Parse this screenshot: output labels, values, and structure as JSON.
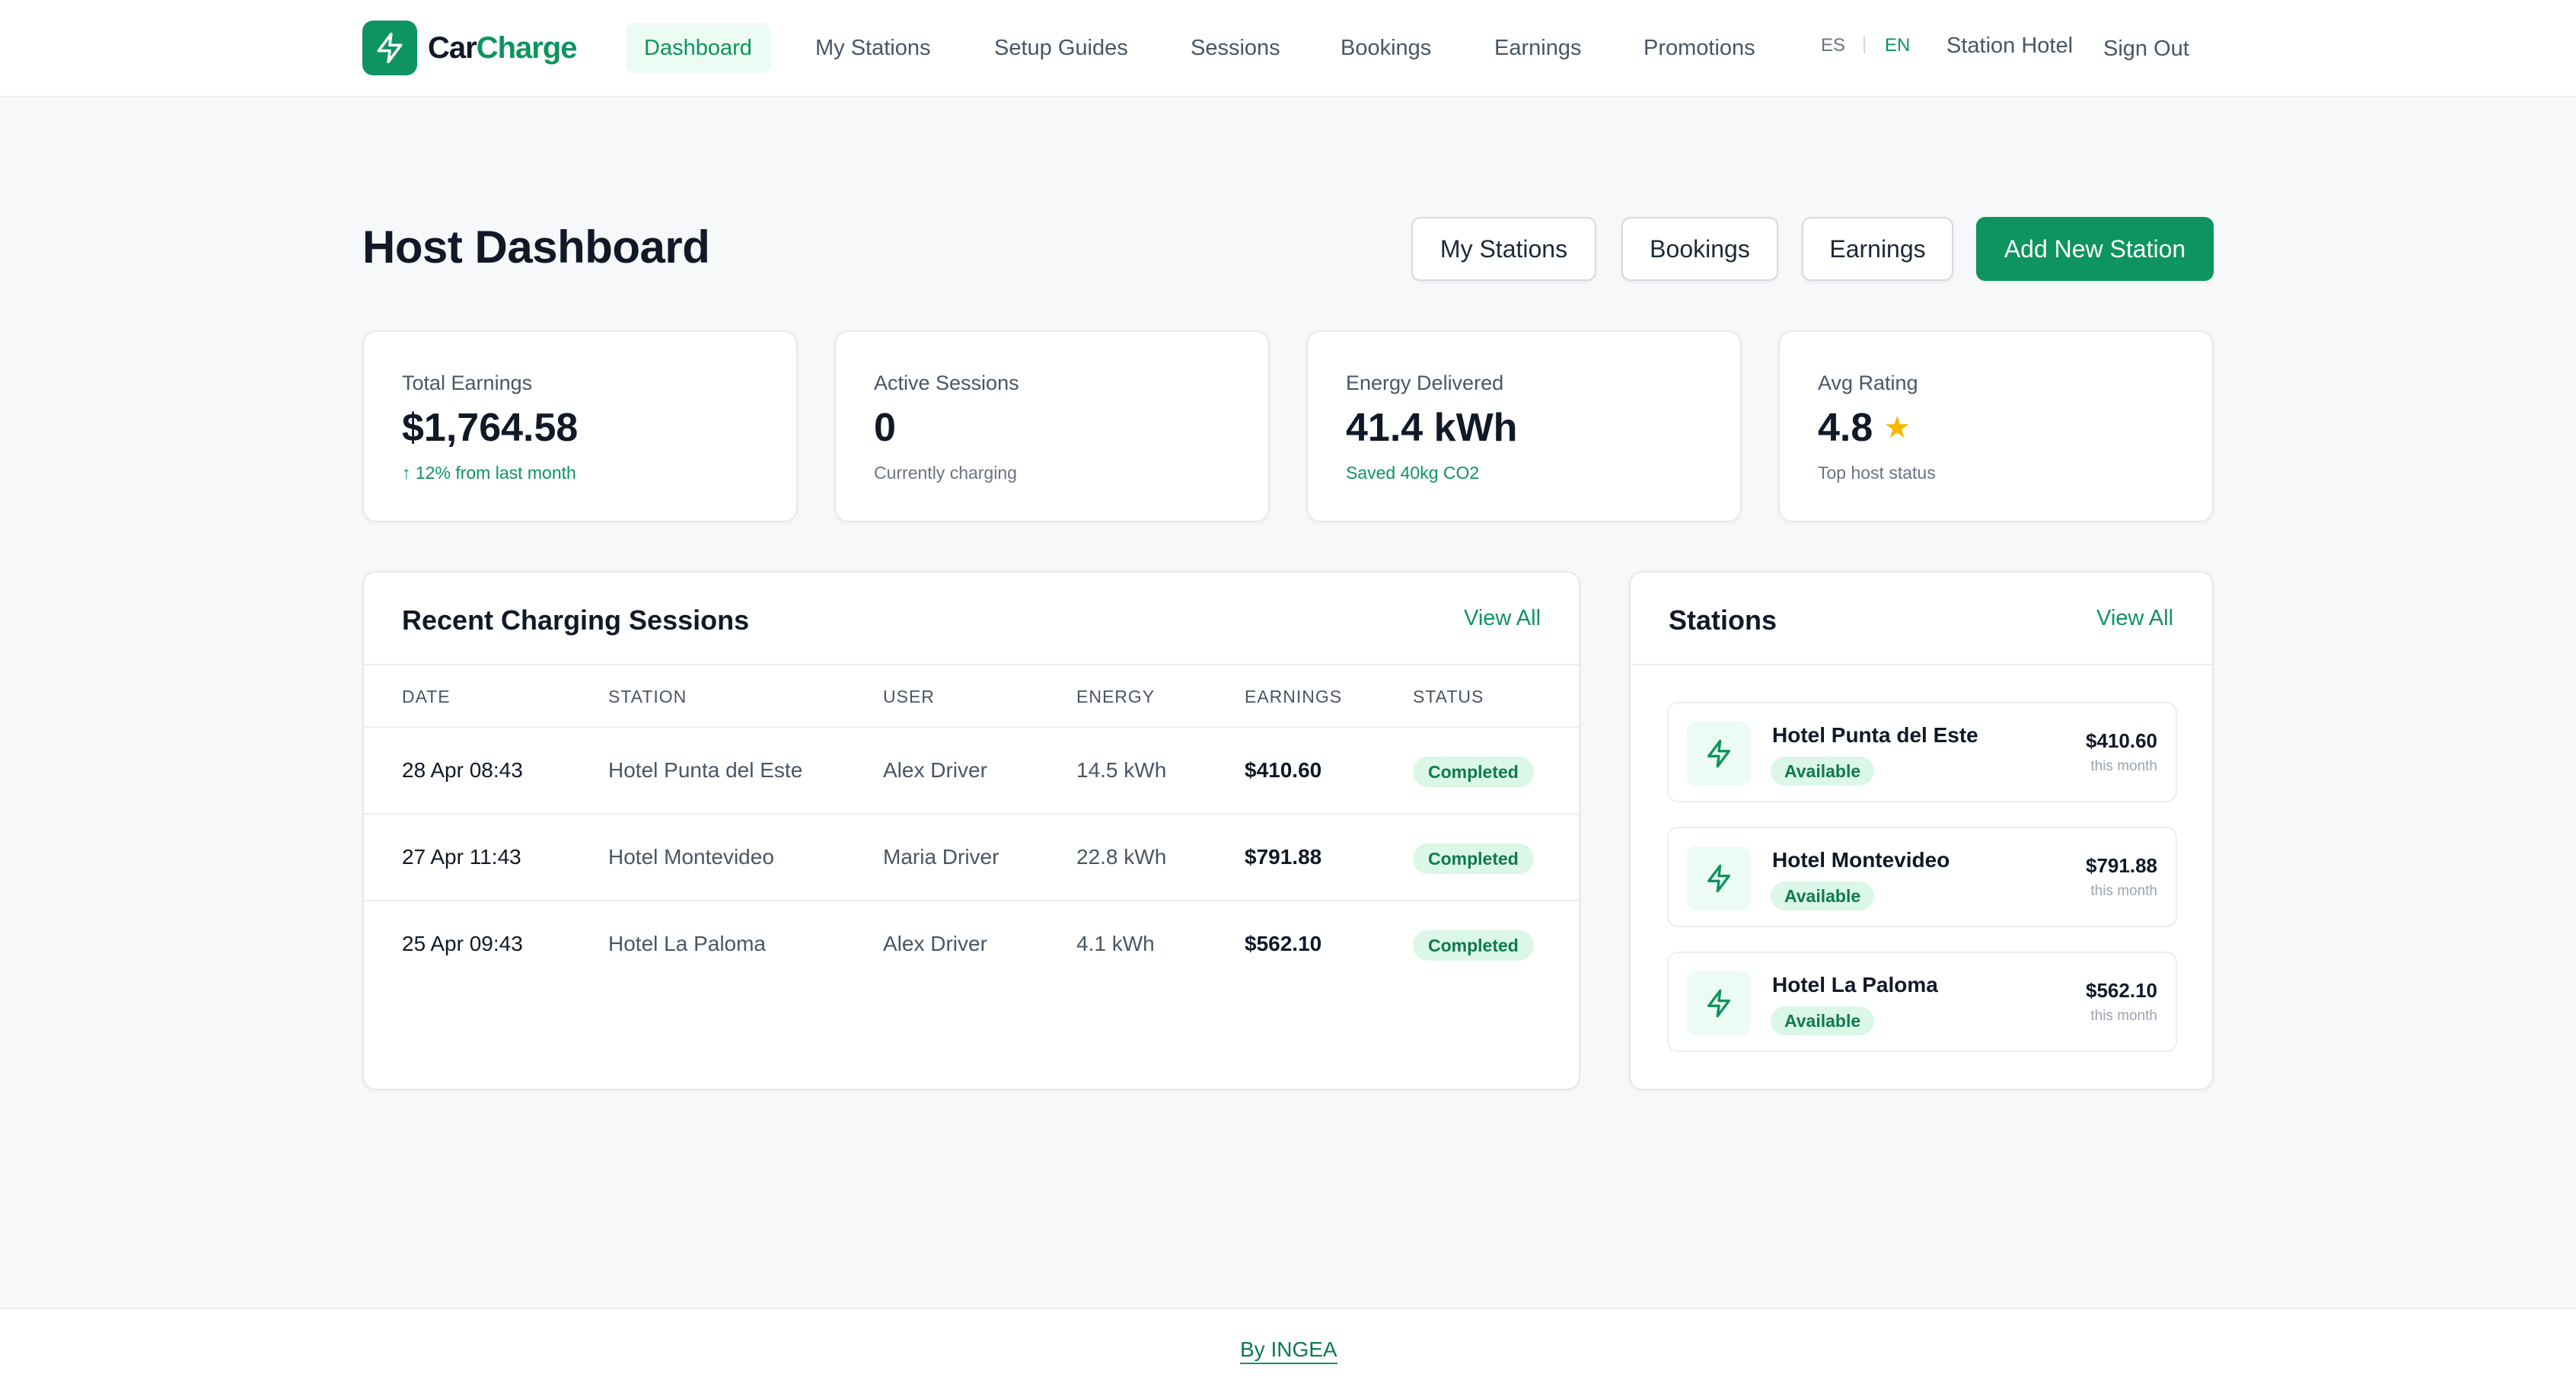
{
  "brand": {
    "part1": "Car",
    "part2": "Charge",
    "accent": "#0d9460",
    "icon": "lightning-bolt-icon"
  },
  "nav": {
    "items": [
      "Dashboard",
      "My Stations",
      "Setup Guides",
      "Sessions",
      "Bookings",
      "Earnings",
      "Promotions"
    ],
    "active": "Dashboard",
    "lang_es": "ES",
    "lang_sep": "|",
    "lang_en": "EN",
    "active_lang": "EN",
    "user": "Station Hotel",
    "sign_out": "Sign Out"
  },
  "header": {
    "title": "Host Dashboard",
    "btn_stations": "My Stations",
    "btn_bookings": "Bookings",
    "btn_earnings": "Earnings",
    "btn_add": "Add New Station"
  },
  "stats": [
    {
      "label": "Total Earnings",
      "value": "$1,764.58",
      "sub": "↑ 12% from last month",
      "sub_color": "green"
    },
    {
      "label": "Active Sessions",
      "value": "0",
      "sub": "Currently charging",
      "sub_color": "gray"
    },
    {
      "label": "Energy Delivered",
      "value": "41.4 kWh",
      "sub": "Saved 40kg CO2",
      "sub_color": "green"
    },
    {
      "label": "Avg Rating",
      "value": "4.8",
      "sub": "Top host status",
      "sub_color": "gray",
      "icon": "star-icon"
    }
  ],
  "sessions": {
    "title": "Recent Charging Sessions",
    "view_all": "View All",
    "columns": [
      "DATE",
      "STATION",
      "USER",
      "ENERGY",
      "EARNINGS",
      "STATUS"
    ],
    "rows": [
      {
        "date": "28 Apr 08:43",
        "station": "Hotel Punta del Este",
        "user": "Alex Driver",
        "energy": "14.5 kWh",
        "earnings": "$410.60",
        "status": "Completed"
      },
      {
        "date": "27 Apr 11:43",
        "station": "Hotel Montevideo",
        "user": "Maria Driver",
        "energy": "22.8 kWh",
        "earnings": "$791.88",
        "status": "Completed"
      },
      {
        "date": "25 Apr 09:43",
        "station": "Hotel La Paloma",
        "user": "Alex Driver",
        "energy": "4.1 kWh",
        "earnings": "$562.10",
        "status": "Completed"
      }
    ]
  },
  "stations": {
    "title": "Stations",
    "view_all": "View All",
    "items": [
      {
        "name": "Hotel Punta del Este",
        "status": "Available",
        "amount": "$410.60",
        "period": "this month"
      },
      {
        "name": "Hotel Montevideo",
        "status": "Available",
        "amount": "$791.88",
        "period": "this month"
      },
      {
        "name": "Hotel La Paloma",
        "status": "Available",
        "amount": "$562.10",
        "period": "this month"
      }
    ]
  },
  "footer": {
    "link": "By INGEA"
  }
}
